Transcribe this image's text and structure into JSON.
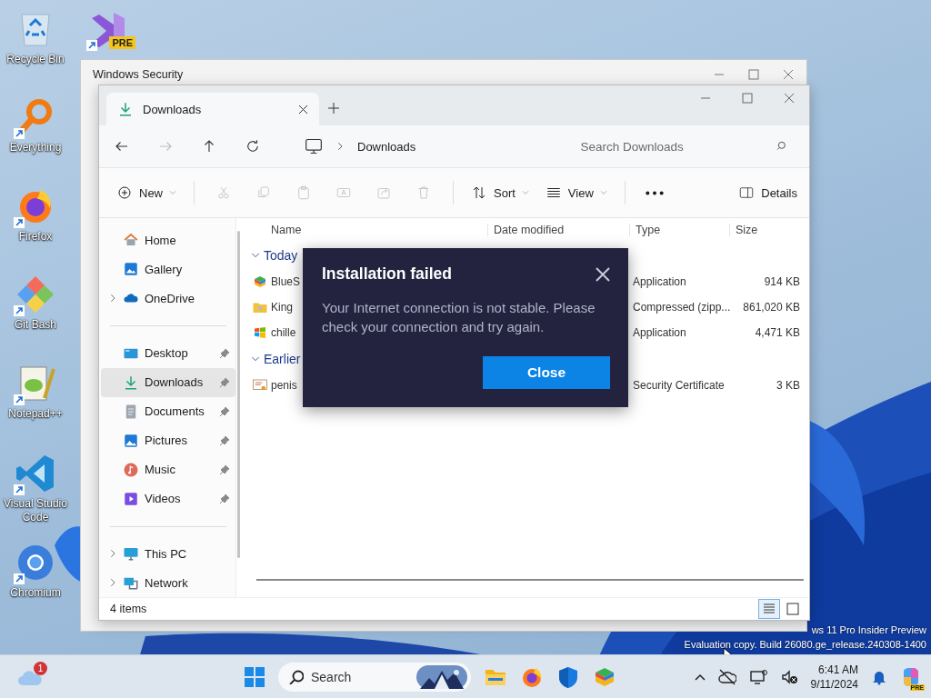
{
  "desktop_icons": [
    {
      "kind": "recycle",
      "label": "Recycle Bin",
      "shortcut": false
    },
    {
      "kind": "visual-studio",
      "badge": "PRE",
      "shortcut": true
    },
    {
      "kind": "everything",
      "label": "Everything",
      "shortcut": true
    },
    {
      "kind": "firefox",
      "label": "Firefox",
      "shortcut": true
    },
    {
      "kind": "gitbash",
      "label": "Git Bash",
      "shortcut": true
    },
    {
      "kind": "notepad",
      "label": "Notepad++",
      "shortcut": true
    },
    {
      "kind": "vscode",
      "label": "Visual Studio Code",
      "shortcut": true
    },
    {
      "kind": "chromium",
      "label": "Chromium",
      "shortcut": true
    }
  ],
  "back_window": {
    "title": "Windows Security"
  },
  "explorer": {
    "tabs": [
      {
        "label": "Downloads",
        "selected": true
      }
    ],
    "nav_buttons": [
      {
        "kind": "back",
        "disabled": false
      },
      {
        "kind": "forward",
        "disabled": true
      },
      {
        "kind": "up",
        "disabled": false
      },
      {
        "kind": "refresh",
        "disabled": false
      }
    ],
    "address": "Downloads",
    "search": {
      "placeholder": "Search Downloads"
    },
    "toolbar": [
      {
        "kind": "new",
        "label": "New",
        "disabled": false
      },
      {
        "kind": "cut",
        "disabled": true
      },
      {
        "kind": "copy",
        "disabled": true
      },
      {
        "kind": "paste",
        "disabled": true
      },
      {
        "kind": "rename",
        "disabled": true
      },
      {
        "kind": "share",
        "disabled": true
      },
      {
        "kind": "delete",
        "disabled": true
      },
      {
        "kind": "sort",
        "label": "Sort",
        "disabled": false
      },
      {
        "kind": "view",
        "label": "View",
        "disabled": false
      },
      {
        "kind": "more",
        "disabled": false
      },
      {
        "kind": "details",
        "label": "Details",
        "disabled": false
      }
    ],
    "sidebar": [
      [
        {
          "kind": "home",
          "label": "Home",
          "expandable": false,
          "pinned": false,
          "selected": false
        },
        {
          "kind": "gallery",
          "label": "Gallery",
          "expandable": false,
          "pinned": false,
          "selected": false
        },
        {
          "kind": "onedrive",
          "label": "OneDrive",
          "expandable": true,
          "pinned": false,
          "selected": false
        }
      ],
      [
        {
          "kind": "desktop",
          "label": "Desktop",
          "expandable": false,
          "pinned": true,
          "selected": false
        },
        {
          "kind": "downloads",
          "label": "Downloads",
          "expandable": false,
          "pinned": true,
          "selected": true
        },
        {
          "kind": "documents",
          "label": "Documents",
          "expandable": false,
          "pinned": true,
          "selected": false
        },
        {
          "kind": "pictures",
          "label": "Pictures",
          "expandable": false,
          "pinned": true,
          "selected": false
        },
        {
          "kind": "music",
          "label": "Music",
          "expandable": false,
          "pinned": true,
          "selected": false
        },
        {
          "kind": "videos",
          "label": "Videos",
          "expandable": false,
          "pinned": true,
          "selected": false
        }
      ],
      [
        {
          "kind": "pc",
          "label": "This PC",
          "expandable": true,
          "pinned": false,
          "selected": false
        },
        {
          "kind": "network",
          "label": "Network",
          "expandable": true,
          "pinned": false,
          "selected": false
        }
      ]
    ],
    "columns": [
      "Name",
      "Date modified",
      "Type",
      "Size"
    ],
    "groups": [
      {
        "label": "Today",
        "expanded": true,
        "rows": [
          {
            "kind": "bluestacks",
            "name": "BlueS",
            "type": "Application",
            "size": "914 KB"
          },
          {
            "kind": "zip",
            "name": "King",
            "type": "Compressed (zipp...",
            "size": "861,020 KB"
          },
          {
            "kind": "app",
            "name": "chille",
            "type": "Application",
            "size": "4,471 KB"
          }
        ]
      },
      {
        "label": "Earlier",
        "expanded": true,
        "rows": [
          {
            "kind": "certificate",
            "name": "penis",
            "type": "Security Certificate",
            "size": "3 KB"
          }
        ]
      }
    ],
    "status": "4 items",
    "views": [
      {
        "kind": "details",
        "selected": true
      },
      {
        "kind": "tiles",
        "selected": false
      }
    ]
  },
  "dialog": {
    "title": "Installation failed",
    "message": "Your Internet connection is not stable. Please check your connection and try again.",
    "button": "Close"
  },
  "watermark": [
    "ws 11 Pro Insider Preview",
    "Evaluation copy. Build 26080.ge_release.240308-1400"
  ],
  "taskbar": {
    "weather_badge": "1",
    "search": {
      "placeholder": "Search"
    },
    "time": "6:41 AM",
    "date": "9/11/2024",
    "copilot_badge": "PRE"
  }
}
